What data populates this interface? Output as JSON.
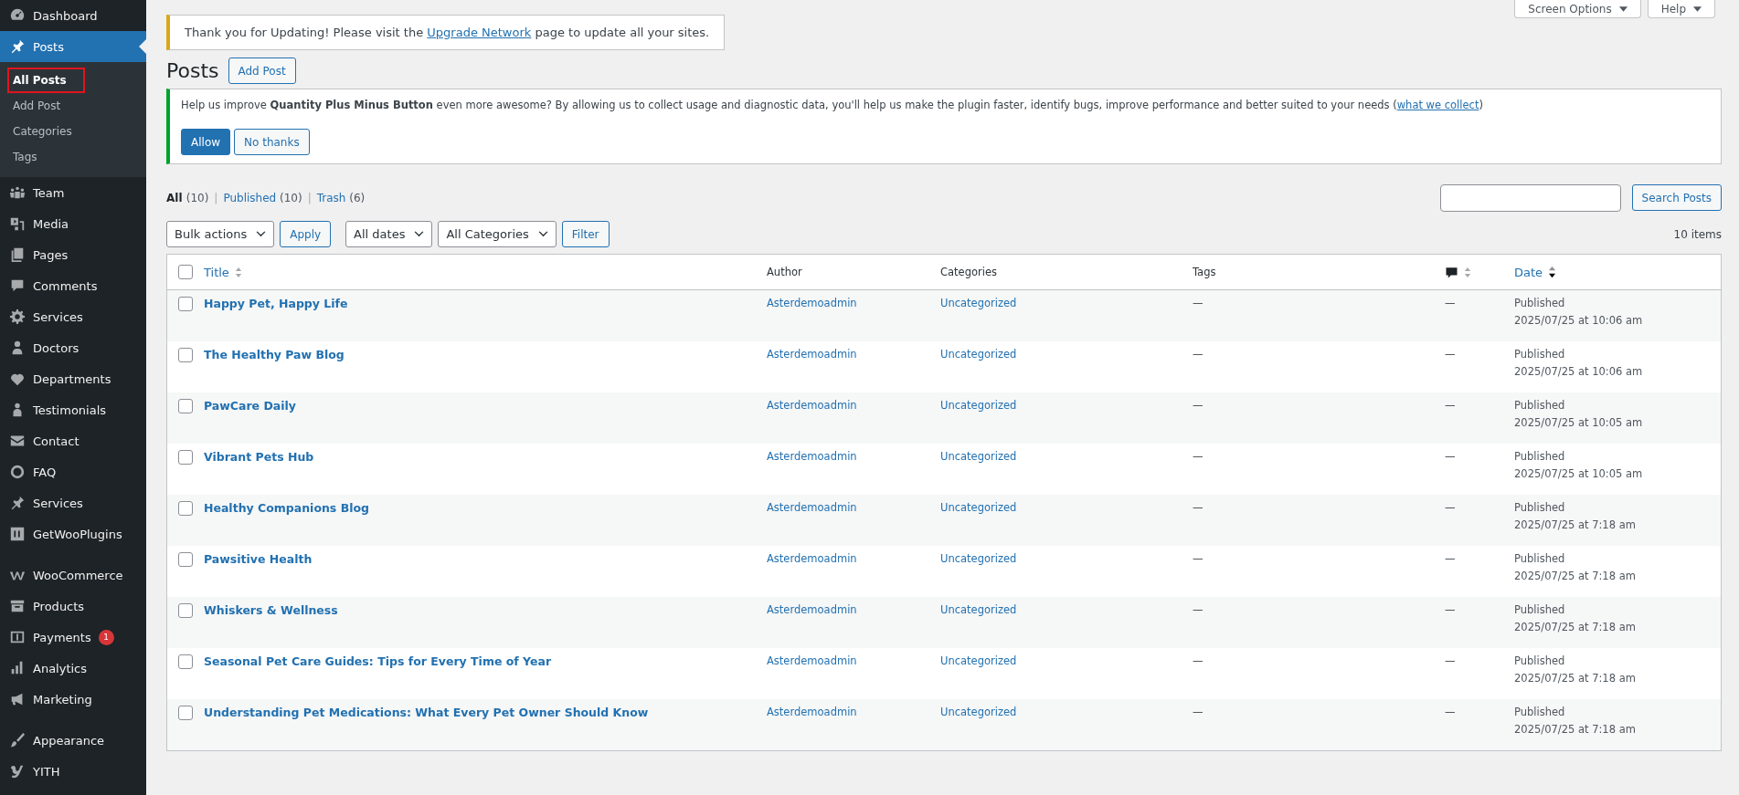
{
  "sidebar": {
    "groups": [
      [
        {
          "label": "Dashboard",
          "selected": false
        },
        {
          "label": "Posts",
          "selected": true,
          "submenu": [
            {
              "label": "All Posts",
              "selected": true,
              "outlined": true
            },
            {
              "label": "Add Post",
              "selected": false,
              "outlined": false
            },
            {
              "label": "Categories",
              "selected": false,
              "outlined": false
            },
            {
              "label": "Tags",
              "selected": false,
              "outlined": false
            }
          ]
        },
        {
          "label": "Team",
          "selected": false
        },
        {
          "label": "Media",
          "selected": false
        },
        {
          "label": "Pages",
          "selected": false
        },
        {
          "label": "Comments",
          "selected": false
        },
        {
          "label": "Services",
          "selected": false
        },
        {
          "label": "Doctors",
          "selected": false
        },
        {
          "label": "Departments",
          "selected": false
        },
        {
          "label": "Testimonials",
          "selected": false
        },
        {
          "label": "Contact",
          "selected": false
        },
        {
          "label": "FAQ",
          "selected": false
        },
        {
          "label": "Services",
          "selected": false
        },
        {
          "label": "GetWooPlugins",
          "selected": false
        }
      ],
      [
        {
          "label": "WooCommerce",
          "selected": false
        },
        {
          "label": "Products",
          "selected": false
        },
        {
          "label": "Payments",
          "selected": false,
          "badge": "1"
        },
        {
          "label": "Analytics",
          "selected": false
        },
        {
          "label": "Marketing",
          "selected": false
        }
      ],
      [
        {
          "label": "Appearance",
          "selected": false
        },
        {
          "label": "YITH",
          "selected": false
        }
      ]
    ]
  },
  "top_tabs": [
    {
      "label": "Screen Options"
    },
    {
      "label": "Help"
    }
  ],
  "update_notice": {
    "before": "Thank you for Updating! Please visit the ",
    "link": "Upgrade Network",
    "after": " page to update all your sites."
  },
  "page_title": "Posts",
  "add_button": "Add Post",
  "plugin_notice": {
    "before": "Help us improve **Quantity Plus Minus Button** even more awesome? By allowing us to collect usage and diagnostic data, you'll help us make the plugin faster, identify bugs, improve performance and better suited to your needs (",
    "link": "what we collect",
    "after": ")",
    "buttons": [
      {
        "label": "Allow",
        "kind": "primary"
      },
      {
        "label": "No thanks",
        "kind": "secondary"
      }
    ]
  },
  "views": {
    "separator": "|",
    "items": [
      {
        "label": "All",
        "count": "(10)",
        "selected": true
      },
      {
        "label": "Published",
        "count": "(10)",
        "selected": false
      },
      {
        "label": "Trash",
        "count": "(6)",
        "selected": false
      }
    ]
  },
  "search": {
    "button": "Search Posts"
  },
  "filters": {
    "bulk": "Bulk actions",
    "apply": "Apply",
    "dates": "All dates",
    "categories": "All Categories",
    "filter": "Filter"
  },
  "item_count": "10 items",
  "table": {
    "select_all_checked": false,
    "columns": [
      {
        "kind": "text",
        "label": "Title",
        "sortable": true,
        "sorted": false
      },
      {
        "kind": "text",
        "label": "Author",
        "sortable": false
      },
      {
        "kind": "text",
        "label": "Categories",
        "sortable": false
      },
      {
        "kind": "text",
        "label": "Tags",
        "sortable": false
      },
      {
        "kind": "comments",
        "sortable": true,
        "sorted": false
      },
      {
        "kind": "text",
        "label": "Date",
        "sortable": true,
        "sorted": true
      }
    ],
    "rows": [
      {
        "checked": false,
        "title": "Happy Pet, Happy Life",
        "author": "Asterdemoadmin",
        "category": "Uncategorized",
        "tags": "—",
        "comments": "—",
        "status": "Published",
        "date": "2025/07/25 at 10:06 am"
      },
      {
        "checked": false,
        "title": "The Healthy Paw Blog",
        "author": "Asterdemoadmin",
        "category": "Uncategorized",
        "tags": "—",
        "comments": "—",
        "status": "Published",
        "date": "2025/07/25 at 10:06 am"
      },
      {
        "checked": false,
        "title": "PawCare Daily",
        "author": "Asterdemoadmin",
        "category": "Uncategorized",
        "tags": "—",
        "comments": "—",
        "status": "Published",
        "date": "2025/07/25 at 10:05 am"
      },
      {
        "checked": false,
        "title": "Vibrant Pets Hub",
        "author": "Asterdemoadmin",
        "category": "Uncategorized",
        "tags": "—",
        "comments": "—",
        "status": "Published",
        "date": "2025/07/25 at 10:05 am"
      },
      {
        "checked": false,
        "title": "Healthy Companions Blog",
        "author": "Asterdemoadmin",
        "category": "Uncategorized",
        "tags": "—",
        "comments": "—",
        "status": "Published",
        "date": "2025/07/25 at 7:18 am"
      },
      {
        "checked": false,
        "title": "Pawsitive Health",
        "author": "Asterdemoadmin",
        "category": "Uncategorized",
        "tags": "—",
        "comments": "—",
        "status": "Published",
        "date": "2025/07/25 at 7:18 am"
      },
      {
        "checked": false,
        "title": "Whiskers & Wellness",
        "author": "Asterdemoadmin",
        "category": "Uncategorized",
        "tags": "—",
        "comments": "—",
        "status": "Published",
        "date": "2025/07/25 at 7:18 am"
      },
      {
        "checked": false,
        "title": "Seasonal Pet Care Guides: Tips for Every Time of Year",
        "author": "Asterdemoadmin",
        "category": "Uncategorized",
        "tags": "—",
        "comments": "—",
        "status": "Published",
        "date": "2025/07/25 at 7:18 am"
      },
      {
        "checked": false,
        "title": "Understanding Pet Medications: What Every Pet Owner Should Know",
        "author": "Asterdemoadmin",
        "category": "Uncategorized",
        "tags": "—",
        "comments": "—",
        "status": "Published",
        "date": "2025/07/25 at 7:18 am"
      }
    ]
  }
}
